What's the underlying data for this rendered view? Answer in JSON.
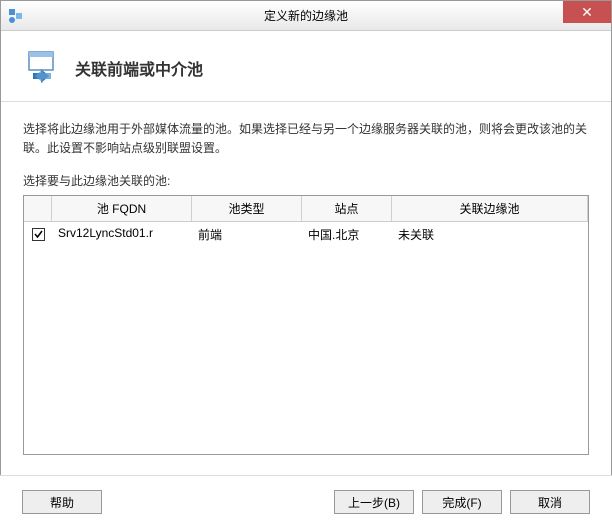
{
  "titlebar": {
    "title": "定义新的边缘池",
    "close": "✕"
  },
  "header": {
    "title": "关联前端或中介池"
  },
  "content": {
    "description": "选择将此边缘池用于外部媒体流量的池。如果选择已经与另一个边缘服务器关联的池，则将会更改该池的关联。此设置不影响站点级别联盟设置。",
    "label": "选择要与此边缘池关联的池:"
  },
  "grid": {
    "headers": {
      "check": "",
      "fqdn": "池 FQDN",
      "type": "池类型",
      "site": "站点",
      "edge": "关联边缘池"
    },
    "rows": [
      {
        "checked": true,
        "fqdn": "Srv12LyncStd01.r",
        "type": "前端",
        "site": "中国.北京",
        "edge": "未关联"
      }
    ]
  },
  "footer": {
    "help": "帮助",
    "back": "上一步(B)",
    "finish": "完成(F)",
    "cancel": "取消"
  }
}
